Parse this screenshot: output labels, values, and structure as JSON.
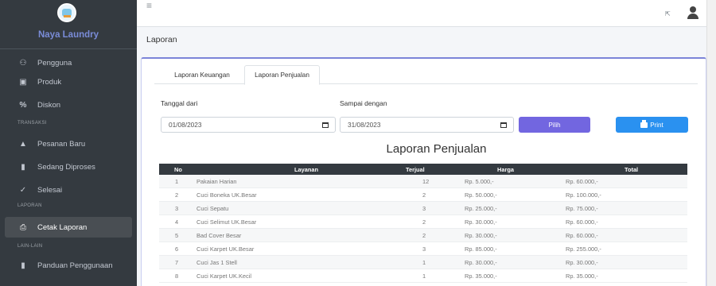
{
  "brand": {
    "name": "Naya Laundry",
    "logo_icon": "laundry-logo-icon"
  },
  "sidebar": {
    "items": [
      {
        "label": "Pengguna",
        "icon": "users-icon"
      },
      {
        "label": "Produk",
        "icon": "box-icon"
      },
      {
        "label": "Diskon",
        "icon": "percent-icon"
      },
      {
        "label": "Pesanan Baru",
        "icon": "warning-icon"
      },
      {
        "label": "Sedang Diproses",
        "icon": "book-icon"
      },
      {
        "label": "Selesai",
        "icon": "check-icon"
      },
      {
        "label": "Cetak Laporan",
        "icon": "print-icon"
      },
      {
        "label": "Panduan Penggunaan",
        "icon": "book-icon"
      }
    ],
    "headers": {
      "transaksi": "TRANSAKSI",
      "laporan": "LAPORAN",
      "lain": "LAIN-LAIN"
    }
  },
  "header": {
    "page_title": "Laporan"
  },
  "tabs": {
    "keuangan": "Laporan Keuangan",
    "penjualan": "Laporan Penjualan"
  },
  "filter": {
    "from_label": "Tanggal dari",
    "from_value": "01/08/2023",
    "to_label": "Sampai dengan",
    "to_value": "31/08/2023",
    "pilih_label": "Pilih",
    "print_label": "Print"
  },
  "report": {
    "title": "Laporan Penjualan",
    "columns": {
      "no": "No",
      "layanan": "Layanan",
      "terjual": "Terjual",
      "harga": "Harga",
      "total": "Total"
    },
    "rows": [
      {
        "no": "1",
        "layanan": "Pakaian Harian",
        "terjual": "12",
        "harga": "Rp. 5.000,-",
        "total": "Rp. 60.000,-"
      },
      {
        "no": "2",
        "layanan": "Cuci Boneka UK.Besar",
        "terjual": "2",
        "harga": "Rp. 50.000,-",
        "total": "Rp. 100.000,-"
      },
      {
        "no": "3",
        "layanan": "Cuci Sepatu",
        "terjual": "3",
        "harga": "Rp. 25.000,-",
        "total": "Rp. 75.000,-"
      },
      {
        "no": "4",
        "layanan": "Cuci Selimut UK.Besar",
        "terjual": "2",
        "harga": "Rp. 30.000,-",
        "total": "Rp. 60.000,-"
      },
      {
        "no": "5",
        "layanan": "Bad Cover Besar",
        "terjual": "2",
        "harga": "Rp. 30.000,-",
        "total": "Rp. 60.000,-"
      },
      {
        "no": "6",
        "layanan": "Cuci Karpet UK.Besar",
        "terjual": "3",
        "harga": "Rp. 85.000,-",
        "total": "Rp. 255.000,-"
      },
      {
        "no": "7",
        "layanan": "Cuci Jas 1 Stell",
        "terjual": "1",
        "harga": "Rp. 30.000,-",
        "total": "Rp. 30.000,-"
      },
      {
        "no": "8",
        "layanan": "Cuci Karpet UK.Kecil",
        "terjual": "1",
        "harga": "Rp. 35.000,-",
        "total": "Rp. 35.000,-"
      }
    ]
  },
  "colors": {
    "sidebar": "#343a40",
    "accent": "#7266e0",
    "print": "#2a91f0",
    "brand_text": "#7a8cd8"
  }
}
